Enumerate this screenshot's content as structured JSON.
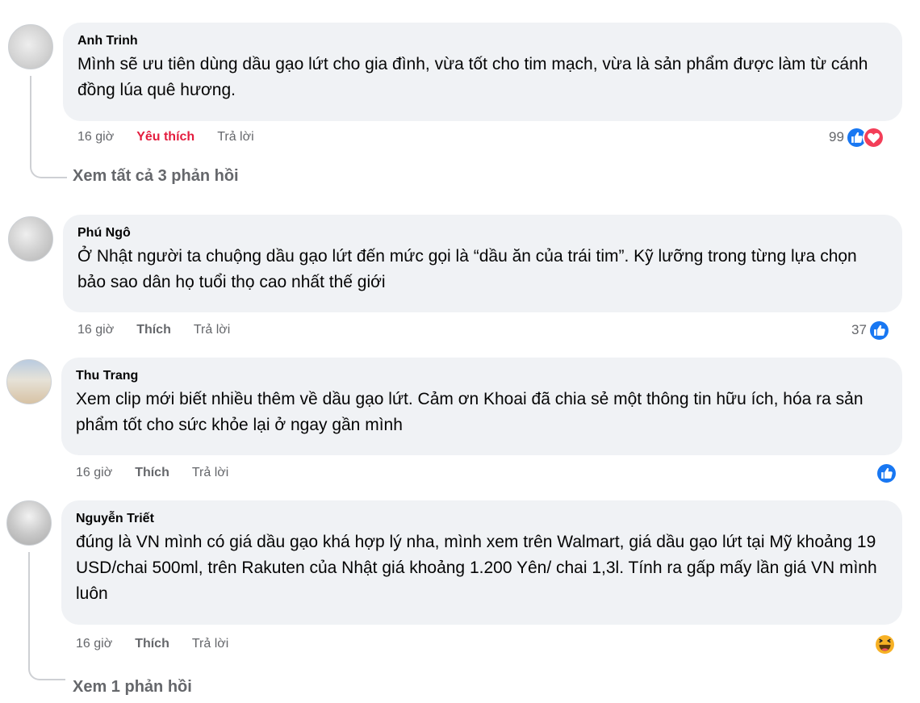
{
  "comments": [
    {
      "author": "Anh Trinh",
      "text": "Mình sẽ ưu tiên dùng dầu gạo lứt cho gia đình, vừa tốt cho tim mạch, vừa là sản phẩm được làm từ cánh đồng lúa quê hương.",
      "time": "16 giờ",
      "like_label": "Yêu thích",
      "reply_label": "Trả lời",
      "reaction_count": "99",
      "reactions": [
        "like-icon",
        "love-icon"
      ],
      "view_replies": "Xem tất cả 3 phản hồi"
    },
    {
      "author": "Phú Ngô",
      "text": "Ở Nhật người ta chuộng dầu gạo lứt đến mức gọi là “dầu ăn của trái tim”. Kỹ lưỡng trong từng lựa chọn bảo sao dân họ tuổi thọ cao nhất thế giới",
      "time": "16 giờ",
      "like_label": "Thích",
      "reply_label": "Trả lời",
      "reaction_count": "37",
      "reactions": [
        "like-icon"
      ]
    },
    {
      "author": "Thu Trang",
      "text": "Xem clip mới biết nhiều thêm về dầu gạo lứt. Cảm ơn Khoai đã chia sẻ một thông tin hữu ích, hóa ra sản phẩm tốt cho sức khỏe lại ở ngay gần mình",
      "time": "16 giờ",
      "like_label": "Thích",
      "reply_label": "Trả lời",
      "reactions": [
        "like-icon"
      ]
    },
    {
      "author": "Nguyễn Triết",
      "text": "đúng là VN mình có giá dầu gạo khá hợp lý nha, mình xem trên Walmart, giá dầu gạo lứt tại Mỹ khoảng 19 USD/chai 500ml, trên Rakuten của Nhật giá khoảng 1.200 Yên/ chai 1,3l. Tính ra gấp mấy lần giá VN mình luôn",
      "time": "16 giờ",
      "like_label": "Thích",
      "reply_label": "Trả lời",
      "reactions": [
        "haha-icon"
      ],
      "view_replies": "Xem 1 phản hồi"
    }
  ],
  "colors": {
    "bubble_bg": "#f0f2f5",
    "meta_text": "#65676b",
    "loved": "#e41e3f",
    "like_blue": "#1877f2",
    "love_red": "#f33e58",
    "haha_yellow": "#f7b125"
  }
}
